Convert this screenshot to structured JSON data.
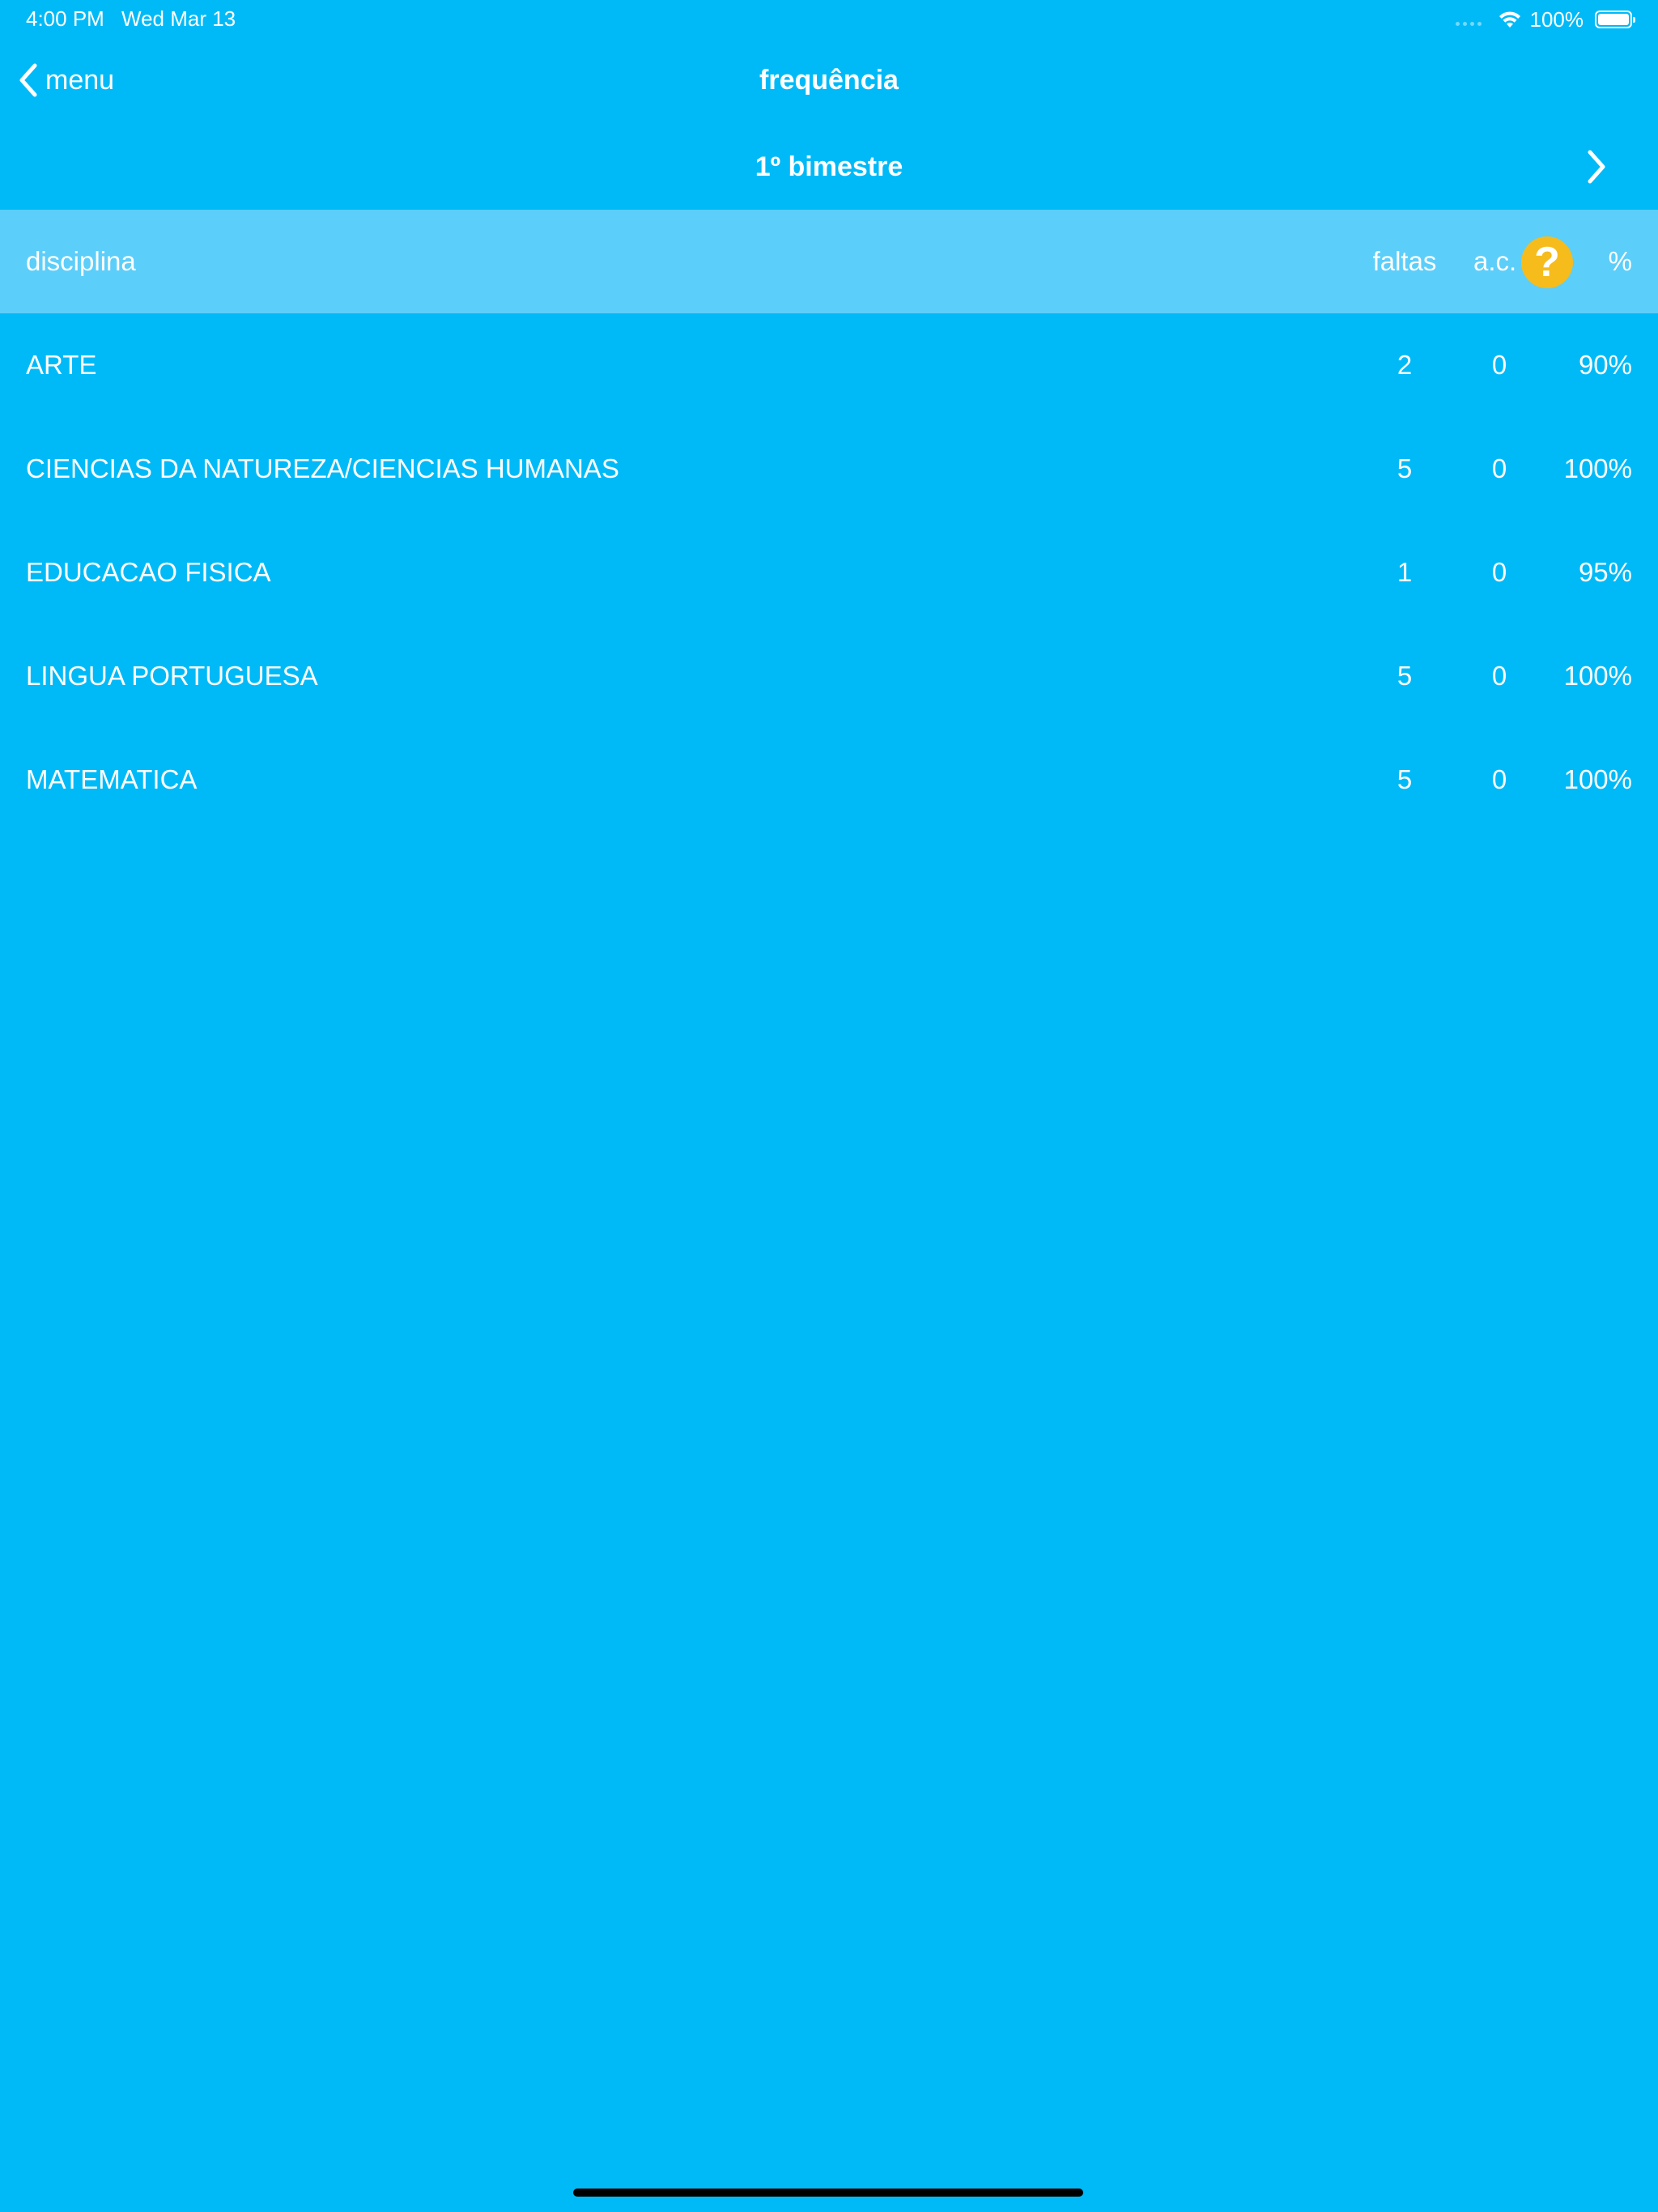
{
  "status_bar": {
    "time": "4:00 PM",
    "date": "Wed Mar 13",
    "battery": "100%",
    "icons": [
      "cellular-dots-icon",
      "wifi-icon",
      "battery-icon"
    ]
  },
  "nav": {
    "back_label": "menu",
    "title": "frequência",
    "back_icon": "chevron-left-icon"
  },
  "period": {
    "title": "1º bimestre",
    "next_icon": "chevron-right-icon"
  },
  "table": {
    "headers": {
      "disciplina": "disciplina",
      "faltas": "faltas",
      "ac": "a.c.",
      "help": "?",
      "pct": "%"
    },
    "rows": [
      {
        "disciplina": "ARTE",
        "faltas": "2",
        "ac": "0",
        "pct": "90%"
      },
      {
        "disciplina": "CIENCIAS DA NATUREZA/CIENCIAS HUMANAS",
        "faltas": "5",
        "ac": "0",
        "pct": "100%"
      },
      {
        "disciplina": "EDUCACAO FISICA",
        "faltas": "1",
        "ac": "0",
        "pct": "95%"
      },
      {
        "disciplina": "LINGUA PORTUGUESA",
        "faltas": "5",
        "ac": "0",
        "pct": "100%"
      },
      {
        "disciplina": "MATEMATICA",
        "faltas": "5",
        "ac": "0",
        "pct": "100%"
      }
    ]
  },
  "colors": {
    "background": "#00BAF8",
    "header_row": "#5CCEFA",
    "help_badge": "#F5BC1C",
    "text": "#FFFFFF"
  }
}
